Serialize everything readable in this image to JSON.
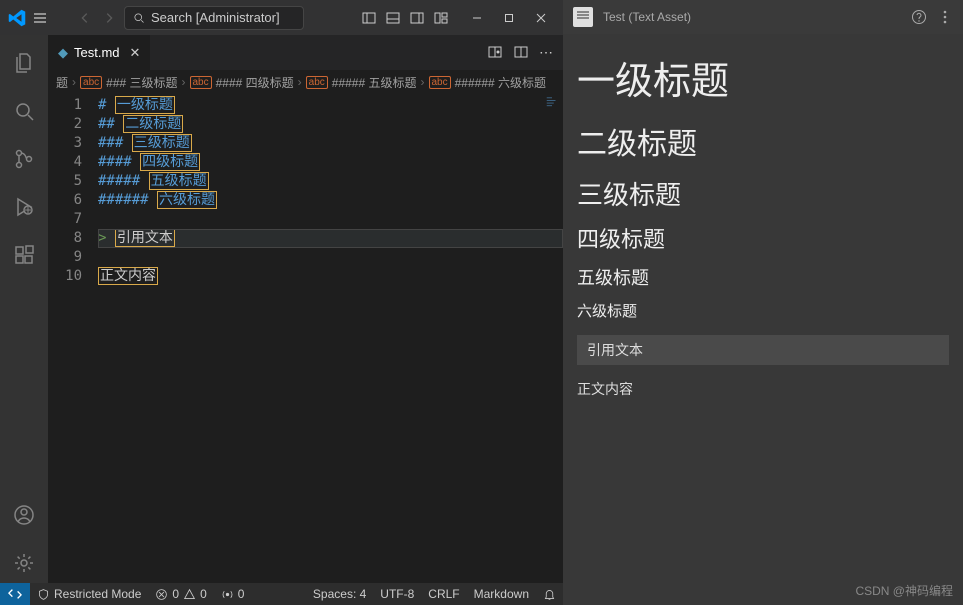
{
  "titlebar": {
    "search_text": "Search [Administrator]"
  },
  "tab": {
    "filename": "Test.md"
  },
  "breadcrumb": {
    "part1": "题",
    "part2": "### 三级标题",
    "part3": "#### 四级标题",
    "part4": "##### 五级标题",
    "part5": "###### 六级标题"
  },
  "editor": {
    "lines": {
      "l1n": "1",
      "l1h": "#",
      "l1t": "一级标题",
      "l2n": "2",
      "l2h": "##",
      "l2t": "二级标题",
      "l3n": "3",
      "l3h": "###",
      "l3t": "三级标题",
      "l4n": "4",
      "l4h": "####",
      "l4t": "四级标题",
      "l5n": "5",
      "l5h": "#####",
      "l5t": "五级标题",
      "l6n": "6",
      "l6h": "######",
      "l6t": "六级标题",
      "l7n": "7",
      "l8n": "8",
      "l8h": ">",
      "l8t": "引用文本",
      "l9n": "9",
      "l10n": "10",
      "l10t": "正文内容"
    }
  },
  "statusbar": {
    "restricted": "Restricted Mode",
    "err": "0",
    "warn": "0",
    "ports": "0",
    "spaces": "Spaces: 4",
    "encoding": "UTF-8",
    "eol": "CRLF",
    "lang": "Markdown"
  },
  "preview": {
    "title": "Test (Text Asset)",
    "h1": "一级标题",
    "h2": "二级标题",
    "h3": "三级标题",
    "h4": "四级标题",
    "h5": "五级标题",
    "h6": "六级标题",
    "quote": "引用文本",
    "body": "正文内容"
  },
  "watermark": "CSDN @神码编程"
}
